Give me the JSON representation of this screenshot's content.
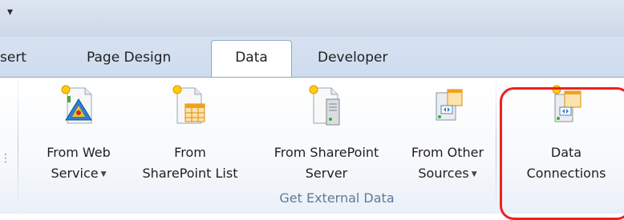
{
  "quick_access": {
    "arrow_icon": "dropdown-arrow-icon"
  },
  "tabs": [
    {
      "label": "sert"
    },
    {
      "label": "Page Design"
    },
    {
      "label": "Data"
    },
    {
      "label": "Developer"
    }
  ],
  "ribbon": {
    "buttons": [
      {
        "line1": "From Web",
        "line2": "Service",
        "dropdown": true,
        "icon": "web-service-icon"
      },
      {
        "line1": "From",
        "line2": "SharePoint List",
        "dropdown": false,
        "icon": "sharepoint-list-icon"
      },
      {
        "line1": "From SharePoint",
        "line2": "Server",
        "dropdown": false,
        "icon": "sharepoint-server-icon"
      },
      {
        "line1": "From Other",
        "line2": "Sources",
        "dropdown": true,
        "icon": "other-sources-icon"
      },
      {
        "line1": "Data",
        "line2": "Connections",
        "dropdown": false,
        "icon": "data-connections-icon"
      }
    ],
    "group_label": "Get External Data"
  },
  "colors": {
    "highlight": "#f02020",
    "tab_border": "#8ea8c9",
    "group_label": "#607a94"
  }
}
